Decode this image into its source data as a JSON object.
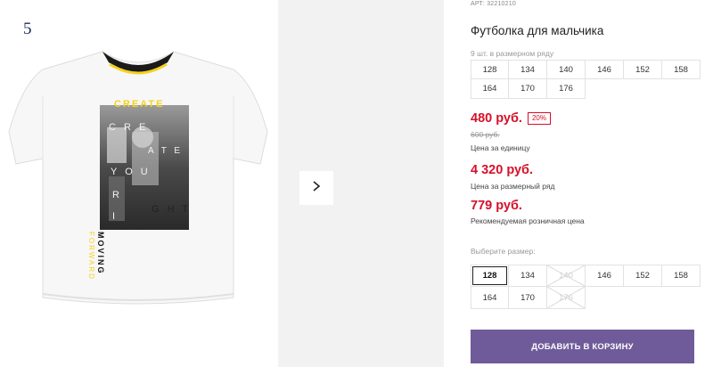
{
  "gallery": {
    "image_index": "5",
    "shirt_print_words": [
      "CREATE",
      "C R E",
      "A T E",
      "Y O U",
      "R",
      "I",
      "G H T",
      "MOVING",
      "FORWARD"
    ]
  },
  "product": {
    "article": "АРТ: 32210210",
    "title": "Футболка для мальчика",
    "pack_note": "9 шт. в размерном ряду",
    "pack_sizes": [
      "128",
      "134",
      "140",
      "146",
      "152",
      "158",
      "164",
      "170",
      "176"
    ]
  },
  "pricing": {
    "unit_price": "480 руб.",
    "discount": "20%",
    "old_price": "600 руб.",
    "unit_label": "Цена за единицу",
    "row_price": "4 320 руб.",
    "row_label": "Цена за размерный ряд",
    "rrp_price": "779 руб.",
    "rrp_label": "Рекомендуемая розничная цена"
  },
  "size_select": {
    "prompt": "Выберите размер:",
    "options": [
      {
        "label": "128",
        "state": "selected"
      },
      {
        "label": "134",
        "state": "available"
      },
      {
        "label": "140",
        "state": "unavailable"
      },
      {
        "label": "146",
        "state": "available"
      },
      {
        "label": "152",
        "state": "available"
      },
      {
        "label": "158",
        "state": "available"
      },
      {
        "label": "164",
        "state": "available"
      },
      {
        "label": "170",
        "state": "available"
      },
      {
        "label": "176",
        "state": "unavailable"
      }
    ]
  },
  "cart": {
    "add_label": "ДОБАВИТЬ В КОРЗИНУ"
  },
  "colors": {
    "price_red": "#d6102a",
    "button_purple": "#6f5b9a",
    "strip_gray": "#f2f2f2",
    "accent_yellow": "#f5d21f"
  },
  "icons": {
    "next": "chevron-right-icon"
  }
}
